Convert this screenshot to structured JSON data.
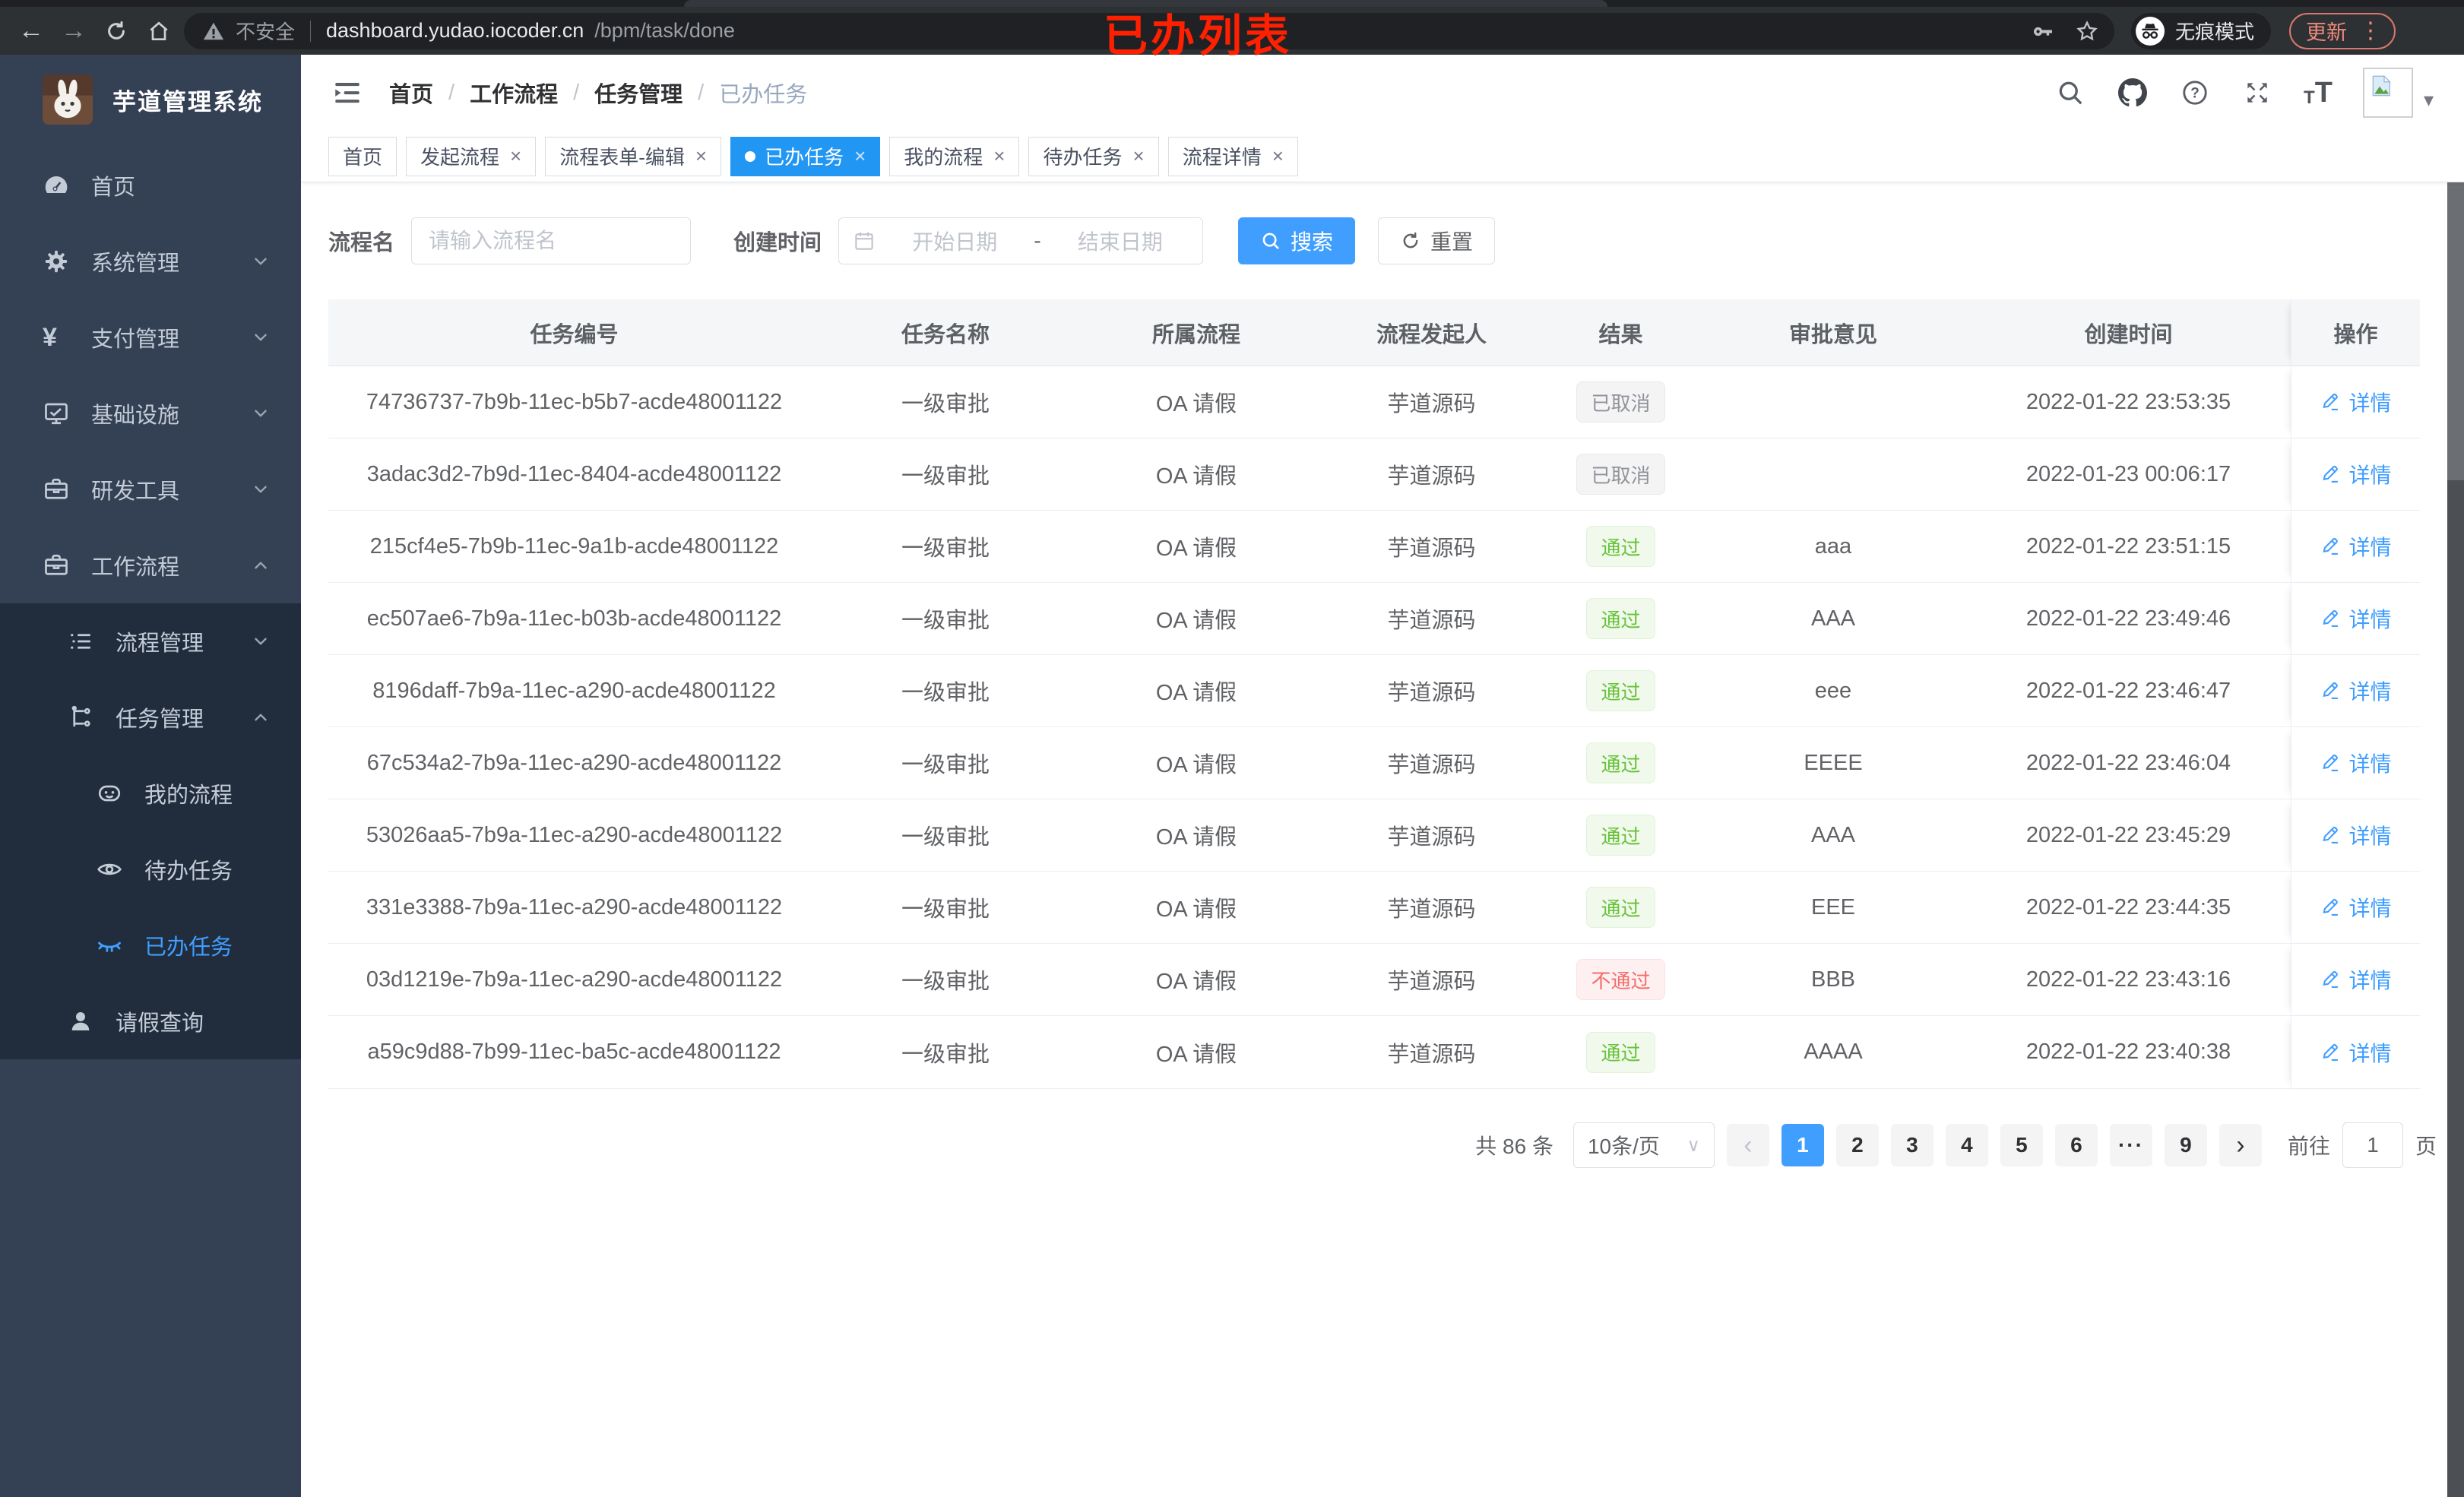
{
  "browser": {
    "security_label": "不安全",
    "url_host": "dashboard.yudao.iocoder.cn",
    "url_path": "/bpm/task/done",
    "incognito_label": "无痕模式",
    "update_button": "更新",
    "more_glyph": "⋮",
    "annotation": "已办列表"
  },
  "sidebar": {
    "app_title": "芋道管理系统",
    "items": [
      {
        "key": "home",
        "label": "首页",
        "icon": "dashboard-icon",
        "level": 1
      },
      {
        "key": "system-management",
        "label": "系统管理",
        "icon": "gear-icon",
        "level": 1,
        "arrow": "down"
      },
      {
        "key": "payment-management",
        "label": "支付管理",
        "icon": "yen-icon",
        "level": 1,
        "arrow": "down"
      },
      {
        "key": "infrastructure",
        "label": "基础设施",
        "icon": "monitor-icon",
        "level": 1,
        "arrow": "down"
      },
      {
        "key": "dev-tools",
        "label": "研发工具",
        "icon": "toolbox-icon",
        "level": 1,
        "arrow": "down"
      },
      {
        "key": "workflow",
        "label": "工作流程",
        "icon": "toolbox-icon",
        "level": 1,
        "arrow": "up"
      },
      {
        "key": "process-management",
        "label": "流程管理",
        "icon": "list-icon",
        "level": 2,
        "sub": true,
        "arrow": "down"
      },
      {
        "key": "task-management",
        "label": "任务管理",
        "icon": "flow-icon",
        "level": 2,
        "sub": true,
        "arrow": "up"
      },
      {
        "key": "my-process",
        "label": "我的流程",
        "icon": "robot-icon",
        "level": 3,
        "sub": true
      },
      {
        "key": "todo-task",
        "label": "待办任务",
        "icon": "eye-icon",
        "level": 3,
        "sub": true
      },
      {
        "key": "done-task",
        "label": "已办任务",
        "icon": "eye-closed-icon",
        "level": 3,
        "sub": true,
        "active": true
      },
      {
        "key": "leave-query",
        "label": "请假查询",
        "icon": "user-icon",
        "level": 2,
        "sub": true
      }
    ]
  },
  "navbar": {
    "breadcrumb": {
      "separator": "/",
      "items": [
        "首页",
        "工作流程",
        "任务管理",
        "已办任务"
      ]
    }
  },
  "tags_bar": {
    "close_glyph": "×",
    "tabs": [
      {
        "key": "home",
        "label": "首页",
        "closable": false,
        "active": false
      },
      {
        "key": "create-process",
        "label": "发起流程",
        "closable": true,
        "active": false
      },
      {
        "key": "form-editor",
        "label": "流程表单-编辑",
        "closable": true,
        "active": false
      },
      {
        "key": "done-tasks",
        "label": "已办任务",
        "closable": true,
        "active": true
      },
      {
        "key": "my-process",
        "label": "我的流程",
        "closable": true,
        "active": false
      },
      {
        "key": "todo-tasks",
        "label": "待办任务",
        "closable": true,
        "active": false
      },
      {
        "key": "process-detail",
        "label": "流程详情",
        "closable": true,
        "active": false
      }
    ]
  },
  "filter": {
    "name_label": "流程名",
    "name_placeholder": "请输入流程名",
    "time_label": "创建时间",
    "start_placeholder": "开始日期",
    "range_separator": "-",
    "end_placeholder": "结束日期",
    "search_label": "搜索",
    "reset_label": "重置"
  },
  "table": {
    "columns": [
      "任务编号",
      "任务名称",
      "所属流程",
      "流程发起人",
      "结果",
      "审批意见",
      "创建时间",
      "操作"
    ],
    "detail_label": "详情",
    "rows": [
      {
        "task_id": "74736737-7b9b-11ec-b5b7-acde48001122",
        "task_name": "一级审批",
        "process": "OA 请假",
        "starter": "芋道源码",
        "result": "已取消",
        "result_state": "cancelled",
        "comment": "",
        "created_at": "2022-01-22 23:53:35"
      },
      {
        "task_id": "3adac3d2-7b9d-11ec-8404-acde48001122",
        "task_name": "一级审批",
        "process": "OA 请假",
        "starter": "芋道源码",
        "result": "已取消",
        "result_state": "cancelled",
        "comment": "",
        "created_at": "2022-01-23 00:06:17"
      },
      {
        "task_id": "215cf4e5-7b9b-11ec-9a1b-acde48001122",
        "task_name": "一级审批",
        "process": "OA 请假",
        "starter": "芋道源码",
        "result": "通过",
        "result_state": "passed",
        "comment": "aaa",
        "created_at": "2022-01-22 23:51:15"
      },
      {
        "task_id": "ec507ae6-7b9a-11ec-b03b-acde48001122",
        "task_name": "一级审批",
        "process": "OA 请假",
        "starter": "芋道源码",
        "result": "通过",
        "result_state": "passed",
        "comment": "AAA",
        "created_at": "2022-01-22 23:49:46"
      },
      {
        "task_id": "8196daff-7b9a-11ec-a290-acde48001122",
        "task_name": "一级审批",
        "process": "OA 请假",
        "starter": "芋道源码",
        "result": "通过",
        "result_state": "passed",
        "comment": "eee",
        "created_at": "2022-01-22 23:46:47"
      },
      {
        "task_id": "67c534a2-7b9a-11ec-a290-acde48001122",
        "task_name": "一级审批",
        "process": "OA 请假",
        "starter": "芋道源码",
        "result": "通过",
        "result_state": "passed",
        "comment": "EEEE",
        "created_at": "2022-01-22 23:46:04"
      },
      {
        "task_id": "53026aa5-7b9a-11ec-a290-acde48001122",
        "task_name": "一级审批",
        "process": "OA 请假",
        "starter": "芋道源码",
        "result": "通过",
        "result_state": "passed",
        "comment": "AAA",
        "created_at": "2022-01-22 23:45:29"
      },
      {
        "task_id": "331e3388-7b9a-11ec-a290-acde48001122",
        "task_name": "一级审批",
        "process": "OA 请假",
        "starter": "芋道源码",
        "result": "通过",
        "result_state": "passed",
        "comment": "EEE",
        "created_at": "2022-01-22 23:44:35"
      },
      {
        "task_id": "03d1219e-7b9a-11ec-a290-acde48001122",
        "task_name": "一级审批",
        "process": "OA 请假",
        "starter": "芋道源码",
        "result": "不通过",
        "result_state": "rejected",
        "comment": "BBB",
        "created_at": "2022-01-22 23:43:16"
      },
      {
        "task_id": "a59c9d88-7b99-11ec-ba5c-acde48001122",
        "task_name": "一级审批",
        "process": "OA 请假",
        "starter": "芋道源码",
        "result": "通过",
        "result_state": "passed",
        "comment": "AAAA",
        "created_at": "2022-01-22 23:40:38"
      }
    ]
  },
  "pagination": {
    "total_label": "共 86 条",
    "page_size": "10条/页",
    "prev_glyph": "‹",
    "next_glyph": "›",
    "pages": [
      {
        "label": "1",
        "active": true
      },
      {
        "label": "2"
      },
      {
        "label": "3"
      },
      {
        "label": "4"
      },
      {
        "label": "5"
      },
      {
        "label": "6"
      },
      {
        "label": "···",
        "ellipsis": true
      },
      {
        "label": "9"
      }
    ],
    "goto_label": "前往",
    "goto_value": "1",
    "goto_suffix": "页"
  },
  "colors": {
    "primary": "#409eff",
    "tag_active": "#2196f3",
    "success": "#67c23a",
    "danger": "#f56c6c",
    "info": "#909399",
    "sidebar_bg": "#344155",
    "submenu_bg": "#212d3d",
    "annotation_red": "#fe2000"
  }
}
